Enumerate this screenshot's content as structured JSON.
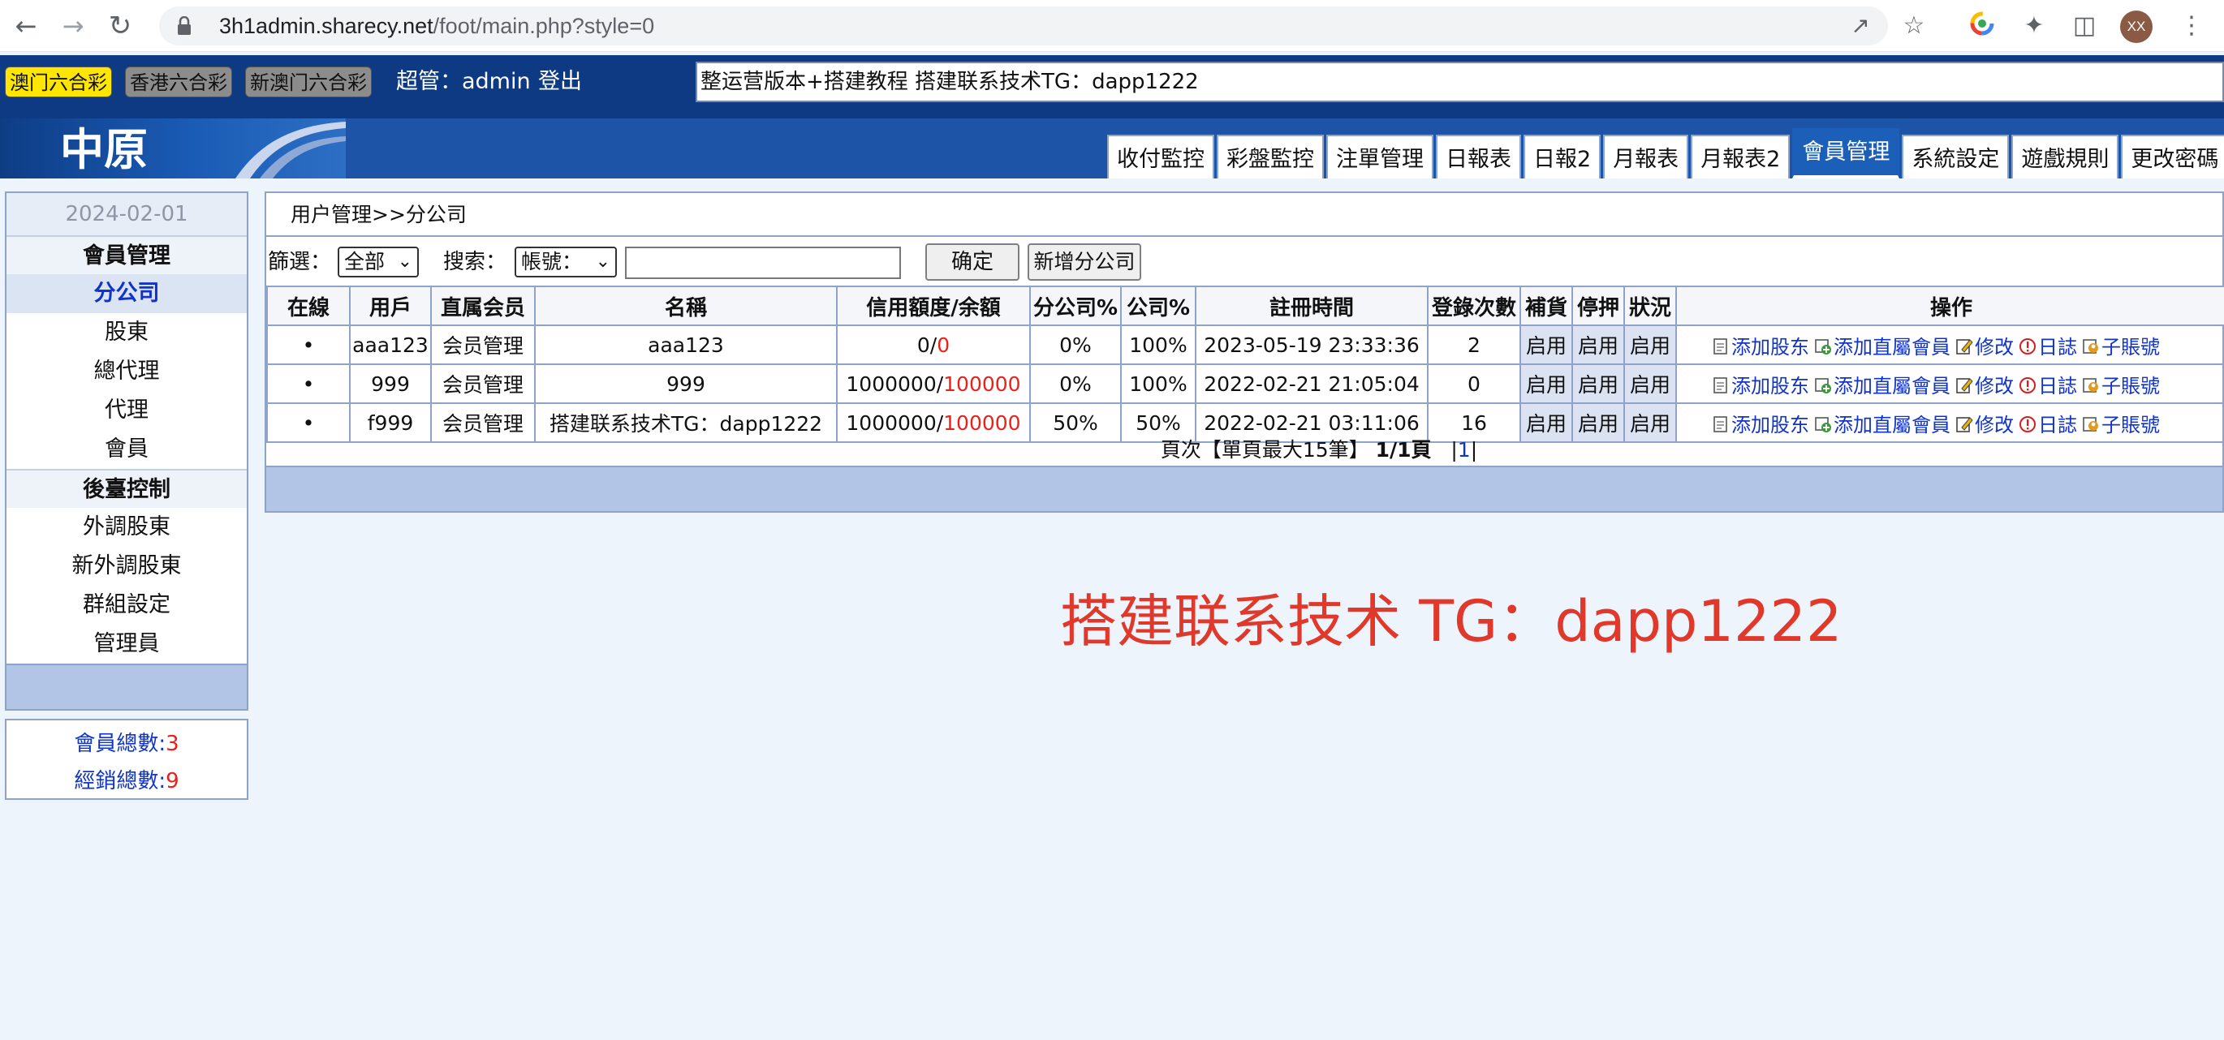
{
  "browser": {
    "url_host": "3h1admin.sharecy.net",
    "url_path": "/foot/main.php?style=0",
    "profile_initials": "XX"
  },
  "topbar": {
    "lotto_tabs": [
      "澳门六合彩",
      "香港六合彩",
      "新澳门六合彩"
    ],
    "admin_label": "超管：admin",
    "logout": "登出",
    "marquee": "整运营版本+搭建教程 搭建联系技术TG：dapp1222"
  },
  "header": {
    "logo": "中原",
    "nav_tabs": [
      "收付監控",
      "彩盤監控",
      "注單管理",
      "日報表",
      "日報2",
      "月報表",
      "月報表2",
      "會員管理",
      "系統設定",
      "遊戲規則",
      "更改密碼"
    ],
    "active_tab": "會員管理"
  },
  "sidebar": {
    "date": "2024-02-01",
    "section1": "會員管理",
    "items1": [
      "分公司",
      "股東",
      "總代理",
      "代理",
      "會員"
    ],
    "section2": "後臺控制",
    "items2": [
      "外調股東",
      "新外調股東",
      "群組設定",
      "管理員"
    ],
    "stats": {
      "members_label": "會員總數:",
      "members_count": "3",
      "dealers_label": "經銷總數:",
      "dealers_count": "9"
    }
  },
  "main": {
    "breadcrumb": "用户管理>>分公司",
    "filter": {
      "filter_label": "篩選：",
      "filter_value": "全部",
      "search_label": "搜索：",
      "search_field": "帳號：",
      "search_value": "",
      "confirm_button": "确定",
      "add_button": "新增分公司"
    },
    "columns": [
      "在線",
      "用戶",
      "直属会员",
      "名稱",
      "信用額度/余額",
      "分公司%",
      "公司%",
      "註冊時間",
      "登錄次數",
      "補貨",
      "停押",
      "狀況",
      "操作"
    ],
    "rows": [
      {
        "online": "•",
        "user": "aaa123",
        "direct": "会员管理",
        "name": "aaa123",
        "credit": "0/",
        "balance": "0",
        "branch_pct": "0%",
        "company_pct": "100%",
        "registered": "2023-05-19 23:33:36",
        "logins": "2",
        "restock": "启用",
        "suspend": "启用",
        "status": "启用"
      },
      {
        "online": "•",
        "user": "999",
        "direct": "会员管理",
        "name": "999",
        "credit": "1000000/",
        "balance": "100000",
        "branch_pct": "0%",
        "company_pct": "100%",
        "registered": "2022-02-21 21:05:04",
        "logins": "0",
        "restock": "启用",
        "suspend": "启用",
        "status": "启用"
      },
      {
        "online": "•",
        "user": "f999",
        "direct": "会员管理",
        "name": "搭建联系技术TG：dapp1222",
        "credit": "1000000/",
        "balance": "100000",
        "branch_pct": "50%",
        "company_pct": "50%",
        "registered": "2022-02-21 03:11:06",
        "logins": "16",
        "restock": "启用",
        "suspend": "启用",
        "status": "启用"
      }
    ],
    "ops": [
      "添加股东",
      "添加直屬會員",
      "修改",
      "日誌",
      "子賬號"
    ],
    "pager": {
      "prefix": "頁次【單頁最大15筆】",
      "pages": "1/1頁",
      "current": "1"
    }
  },
  "watermark": "搭建联系技术 TG：dapp1222",
  "colors": {
    "topbar": "#0d3a82",
    "header": "#1d54a8",
    "link": "#1033cc",
    "red": "#e8221a",
    "highlight": "#ffe600"
  }
}
